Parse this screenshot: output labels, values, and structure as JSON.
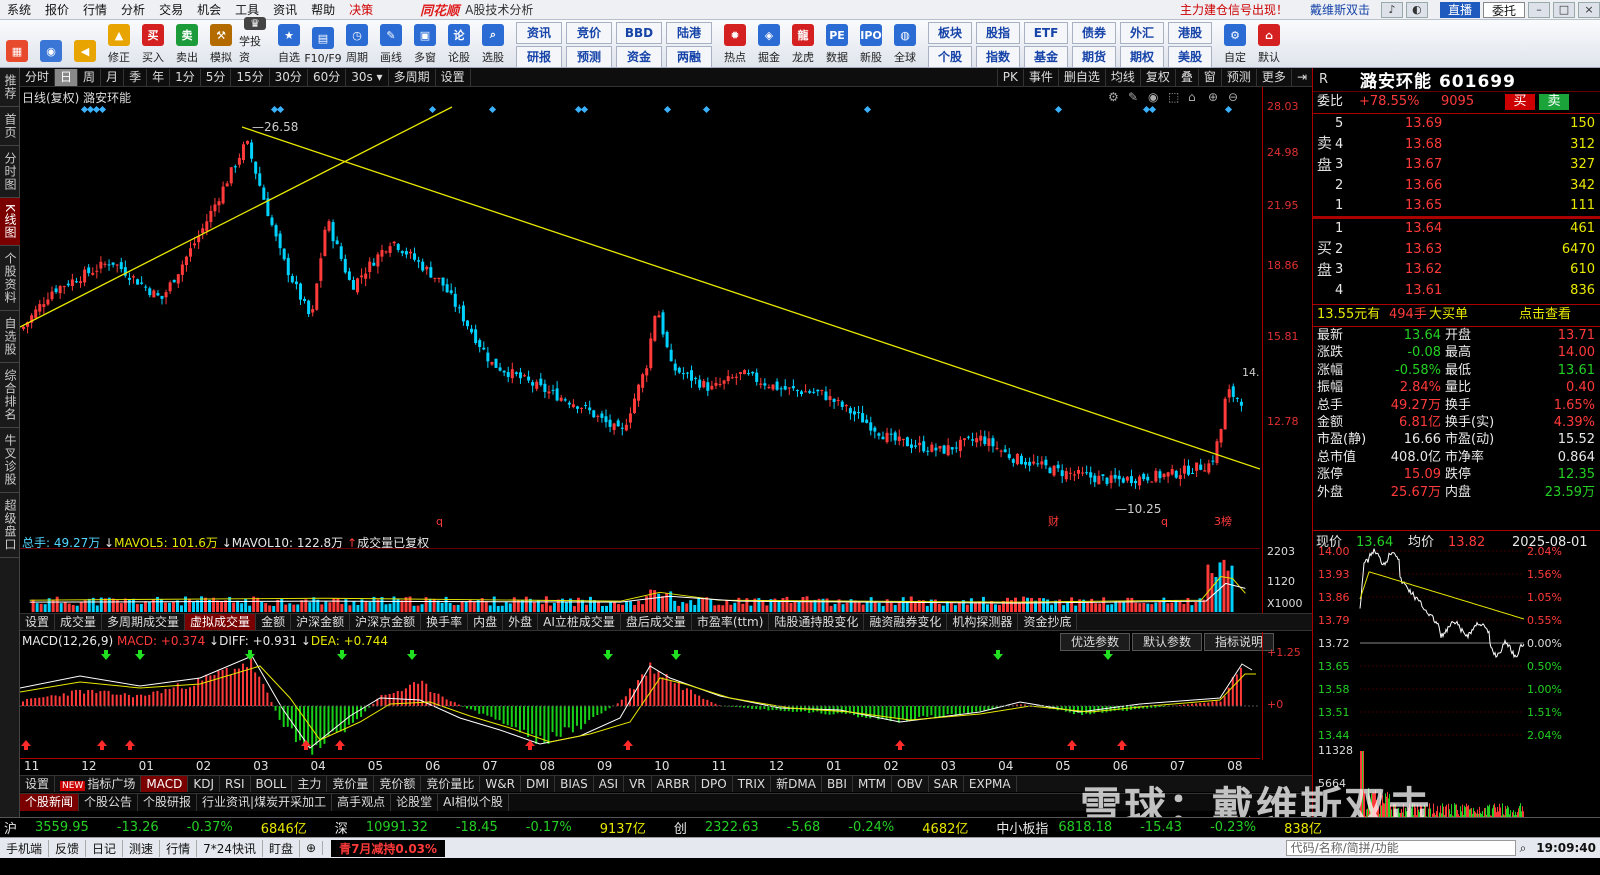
{
  "menu": {
    "items": [
      "系统",
      "报价",
      "行情",
      "分析",
      "交易",
      "机会",
      "工具",
      "资讯",
      "帮助",
      "决策"
    ],
    "brand": "同花顺",
    "subtitle": "A股技术分析",
    "alert": "主力建仓信号出现！",
    "username": "戴维斯双击",
    "mode": "直播",
    "entrust": "委托"
  },
  "toolbar": {
    "left": [
      {
        "label": "",
        "icon": "grid-icon",
        "color": "#e84a2e"
      },
      {
        "label": "",
        "icon": "robot-icon",
        "color": "#3a76d6"
      },
      {
        "label": "",
        "icon": "back-arrow-icon",
        "color": "#e8a400"
      },
      {
        "label": "修正",
        "icon": "up-arrow-icon",
        "color": "#e8a400"
      },
      {
        "label": "买入",
        "icon": "buy-icon",
        "color": "#d42020"
      },
      {
        "label": "卖出",
        "icon": "sell-icon",
        "color": "#1b9b3a"
      },
      {
        "label": "模拟",
        "icon": "hammer-icon",
        "color": "#b36b00"
      },
      {
        "label": "学投资",
        "icon": "hat-icon",
        "color": "#444"
      },
      {
        "label": "自选",
        "icon": "star-icon",
        "color": "#2a6bd4"
      },
      {
        "label": "F10/F9",
        "icon": "document-icon",
        "color": "#2a6bd4"
      },
      {
        "label": "周期",
        "icon": "clock-icon",
        "color": "#2a6bd4"
      },
      {
        "label": "画线",
        "icon": "pen-icon",
        "color": "#2a6bd4"
      },
      {
        "label": "多窗",
        "icon": "window-icon",
        "color": "#2a6bd4"
      },
      {
        "label": "论股",
        "icon": "discuss-icon",
        "color": "#2a6bd4"
      },
      {
        "label": "选股",
        "icon": "search-icon",
        "color": "#2a6bd4"
      }
    ],
    "grid1": [
      "资讯",
      "竞价",
      "BBD",
      "陆港",
      "研报",
      "预测",
      "资金",
      "两融"
    ],
    "mid": [
      {
        "label": "热点",
        "icon": "fire-icon",
        "color": "#d42020"
      },
      {
        "label": "掘金",
        "icon": "gold-icon",
        "color": "#2a6bd4"
      },
      {
        "label": "龙虎",
        "icon": "dragon-icon",
        "color": "#d42020"
      },
      {
        "label": "数据",
        "icon": "pe-icon",
        "color": "#2a6bd4"
      },
      {
        "label": "新股",
        "icon": "ipo-icon",
        "color": "#2a6bd4"
      },
      {
        "label": "全球",
        "icon": "globe-icon",
        "color": "#2a6bd4"
      }
    ],
    "grid2": [
      "板块",
      "股指",
      "ETF",
      "债券",
      "外汇",
      "港股",
      "个股",
      "指数",
      "基金",
      "期货",
      "期权",
      "美股"
    ],
    "right": [
      {
        "label": "自定",
        "icon": "custom-icon",
        "color": "#2a6bd4"
      },
      {
        "label": "默认",
        "icon": "home-icon",
        "color": "#d42020"
      }
    ]
  },
  "sidebar": [
    "推荐",
    "首页",
    "分时图",
    "K线图",
    "个股资料",
    "自选股",
    "综合排名",
    "牛叉诊股",
    "超级盘口"
  ],
  "periodbar": {
    "left": [
      "分时",
      "日",
      "周",
      "月",
      "季",
      "年",
      "1分",
      "5分",
      "15分",
      "30分",
      "60分",
      "30s ▾",
      "多周期",
      "设置"
    ],
    "right": [
      "PK",
      "事件",
      "删自选",
      "均线",
      "复权",
      "叠",
      "窗",
      "预测",
      "更多"
    ]
  },
  "chart": {
    "title": "日线(复权) 潞安环能",
    "high_label": "26.58",
    "low_label": "10.25",
    "last_label": "14.",
    "markers": [
      "q",
      "财",
      "q",
      "3榜"
    ]
  },
  "volume": {
    "label": "总手: 49.27万",
    "mavol5": "MAVOL5: 101.6万",
    "mavol10": "MAVOL10: 122.8万",
    "note": "成交量已复权",
    "axis": [
      "2203",
      "1120",
      "X1000"
    ]
  },
  "indtabs": [
    "设置",
    "成交量",
    "多周期成交量",
    "虚拟成交量",
    "金额",
    "沪深金额",
    "沪深京金额",
    "换手率",
    "内盘",
    "外盘",
    "AI立桩成交量",
    "盘后成交量",
    "市盈率(ttm)",
    "陆股通持股变化",
    "融资融券变化",
    "机构探测器",
    "资金抄底"
  ],
  "macd": {
    "title": "MACD(12,26,9)",
    "macd": "MACD: +0.374",
    "diff": "DIFF: +0.931",
    "dea": "DEA: +0.744",
    "buttons": [
      "优选参数",
      "默认参数",
      "指标说明"
    ],
    "axis": [
      "+1.25",
      "+0"
    ]
  },
  "months": [
    "11",
    "12",
    "01",
    "02",
    "03",
    "04",
    "05",
    "06",
    "07",
    "08",
    "09",
    "10",
    "11",
    "12",
    "01",
    "02",
    "03",
    "04",
    "05",
    "06",
    "07",
    "08"
  ],
  "indlist": [
    "设置",
    "指标广场",
    "MACD",
    "KDJ",
    "RSI",
    "BOLL",
    "主力",
    "竞价量",
    "竞价额",
    "竞价量比",
    "W&R",
    "DMI",
    "BIAS",
    "ASI",
    "VR",
    "ARBR",
    "DPO",
    "TRIX",
    "新DMA",
    "BBI",
    "MTM",
    "OBV",
    "SAR",
    "EXPMA"
  ],
  "newslist": [
    "个股新闻",
    "个股公告",
    "个股研报",
    "行业资讯|煤炭开采加工",
    "高手观点",
    "论股堂",
    "AI相似个股"
  ],
  "quote": {
    "code_r": "R",
    "name": "潞安环能 601699",
    "weibi_label": "委比",
    "weibi": "+78.55%",
    "weicha": "9095",
    "buy": "买",
    "sell": "卖",
    "sell_side": "卖盘",
    "buy_side": "买盘",
    "asks": [
      {
        "lv": "5",
        "p": "13.69",
        "v": "150"
      },
      {
        "lv": "4",
        "p": "13.68",
        "v": "312"
      },
      {
        "lv": "3",
        "p": "13.67",
        "v": "327"
      },
      {
        "lv": "2",
        "p": "13.66",
        "v": "342"
      },
      {
        "lv": "1",
        "p": "13.65",
        "v": "111"
      }
    ],
    "bids": [
      {
        "lv": "1",
        "p": "13.64",
        "v": "461"
      },
      {
        "lv": "2",
        "p": "13.63",
        "v": "6470"
      },
      {
        "lv": "3",
        "p": "13.62",
        "v": "610"
      },
      {
        "lv": "4",
        "p": "13.61",
        "v": "836"
      }
    ],
    "bigorder": {
      "price": "13.55元有",
      "vol": "494手",
      "txt": "大买单",
      "link": "点击查看"
    },
    "stats": [
      [
        "最新",
        "13.64",
        "开盘",
        "13.71"
      ],
      [
        "涨跌",
        "-0.08",
        "最高",
        "14.00"
      ],
      [
        "涨幅",
        "-0.58%",
        "最低",
        "13.61"
      ],
      [
        "振幅",
        "2.84%",
        "量比",
        "0.40"
      ],
      [
        "总手",
        "49.27万",
        "换手",
        "1.65%"
      ],
      [
        "金额",
        "6.81亿",
        "换手(实)",
        "4.39%"
      ],
      [
        "市盈(静)",
        "16.66",
        "市盈(动)",
        "15.52"
      ],
      [
        "总市值",
        "408.0亿",
        "市净率",
        "0.864"
      ],
      [
        "涨停",
        "15.09",
        "跌停",
        "12.35"
      ],
      [
        "外盘",
        "25.67万",
        "内盘",
        "23.59万"
      ]
    ],
    "minute": {
      "now_label": "现价",
      "now": "13.64",
      "avg_label": "均价",
      "avg": "13.82",
      "date": "2025-08-01",
      "yl": [
        "14.00",
        "13.93",
        "13.86",
        "13.79",
        "13.72",
        "13.65",
        "13.58",
        "13.51",
        "13.44"
      ],
      "yr": [
        "2.04%",
        "1.56%",
        "1.05%",
        "0.55%",
        "0.00%",
        "0.50%",
        "1.00%",
        "1.51%",
        "2.04%"
      ],
      "vl": [
        "11328",
        "5664"
      ]
    }
  },
  "status": {
    "sh_label": "沪",
    "sh": "3559.95",
    "sh_chg": "-13.26",
    "sh_pct": "-0.37%",
    "sh_amt": "6846亿",
    "sz_label": "深",
    "sz": "10991.32",
    "sz_chg": "-18.45",
    "sz_pct": "-0.17%",
    "sz_amt": "9137亿",
    "cy_label": "创",
    "cy": "2322.63",
    "cy_chg": "-5.68",
    "cy_pct": "-0.24%",
    "cy_amt": "4682亿",
    "zx_label": "中小板指",
    "zx": "6818.18",
    "zx_chg": "-15.43",
    "zx_pct": "-0.23%",
    "zx_amt": "838亿"
  },
  "bottom": {
    "items": [
      "手机端",
      "反馈",
      "日记",
      "测速",
      "行情",
      "7*24快讯",
      "盯盘"
    ],
    "highlight": "青7月减持0.03%",
    "search": "代码/名称/简拼/功能",
    "clock": "19:09:40"
  },
  "watermark": "雪球：戴维斯双击",
  "colors": {
    "up": "#ff3a3a",
    "down": "#00d2ff",
    "trend": "#e8e800",
    "ma_white": "#e8e8e8"
  }
}
